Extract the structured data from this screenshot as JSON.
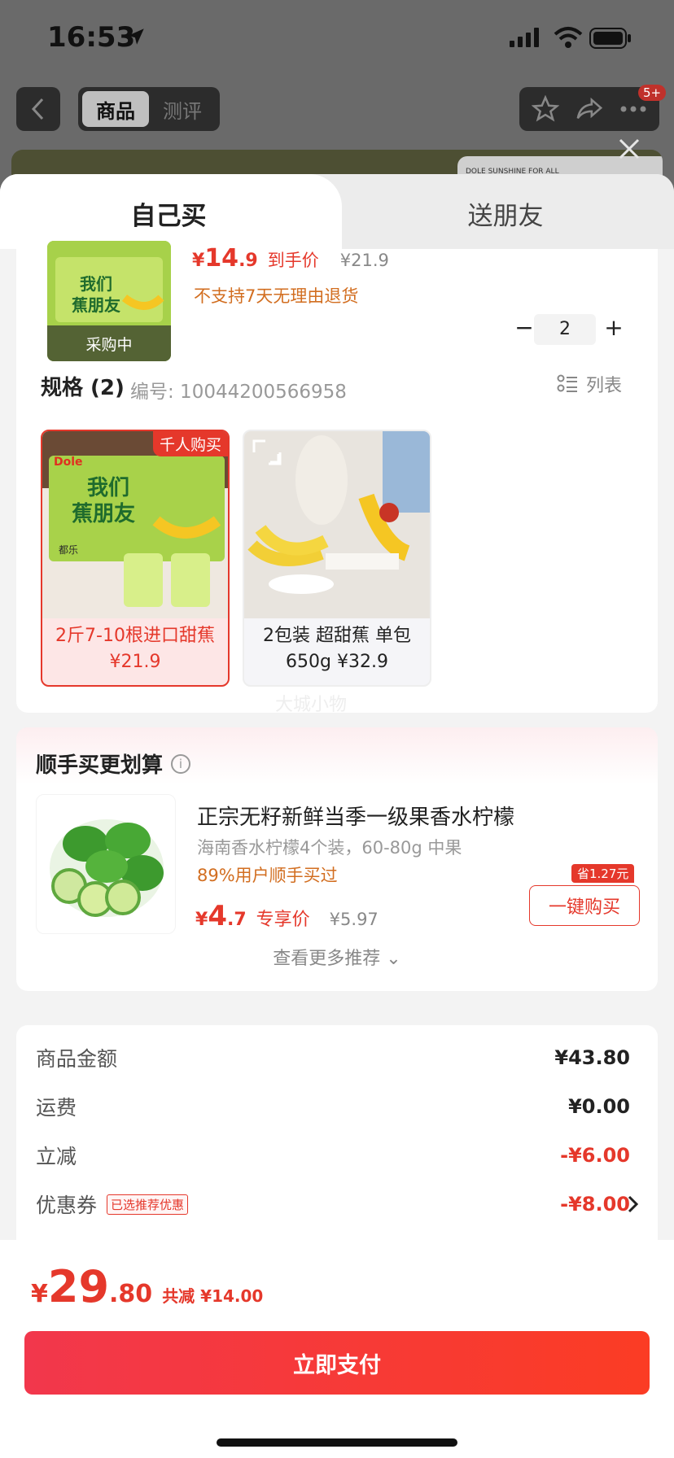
{
  "status_bar": {
    "time": "16:53"
  },
  "nav": {
    "tab_product": "商品",
    "tab_review": "测评",
    "badge": "5+"
  },
  "banner": {
    "brand_text": "DOLE SUNSHINE FOR ALL"
  },
  "sheet": {
    "tab_self": "自己买",
    "tab_friend": "送朋友"
  },
  "product": {
    "thumb_label": "采购中",
    "price_symbol": "¥",
    "price_int": "14",
    "price_dec": ".9",
    "price_tag": "到手价",
    "price_orig": "¥21.9",
    "return_note": "不支持7天无理由退货",
    "quantity": "2",
    "minus": "−",
    "plus": "+",
    "spec_title": "规格 (2)",
    "spec_code": "编号: 10044200566958",
    "list_toggle": "列表",
    "watermark": "大城小物",
    "specs": [
      {
        "badge": "千人购买",
        "line1": "2斤7-10根进口甜蕉",
        "line2": "¥21.9"
      },
      {
        "line1": "2包装 超甜蕉 单包",
        "line2": "650g ¥32.9"
      }
    ]
  },
  "upsell": {
    "title": "顺手买更划算",
    "info": "i",
    "name": "正宗无籽新鲜当季一级果香水柠檬",
    "desc": "海南香水柠檬4个装，60-80g 中果",
    "pct": "89%用户顺手买过",
    "price_symbol": "¥",
    "price_int": "4",
    "price_dec": ".7",
    "price_tag": "专享价",
    "price_orig": "¥5.97",
    "save_badge": "省1.27元",
    "button": "一键购买",
    "see_more": "查看更多推荐 ⌄"
  },
  "summary": {
    "rows": [
      {
        "label": "商品金额",
        "value": "¥43.80"
      },
      {
        "label": "运费",
        "value": "¥0.00"
      },
      {
        "label": "立减",
        "value": "-¥6.00"
      },
      {
        "label": "优惠券",
        "tag": "已选推荐优惠",
        "value": "-¥8.00"
      }
    ]
  },
  "footer": {
    "sym": "¥",
    "int": "29",
    "dec": ".80",
    "save": "共减 ¥14.00",
    "pay": "立即支付"
  },
  "colors": {
    "accent": "#e5382b",
    "orange_note": "#d26e20"
  }
}
